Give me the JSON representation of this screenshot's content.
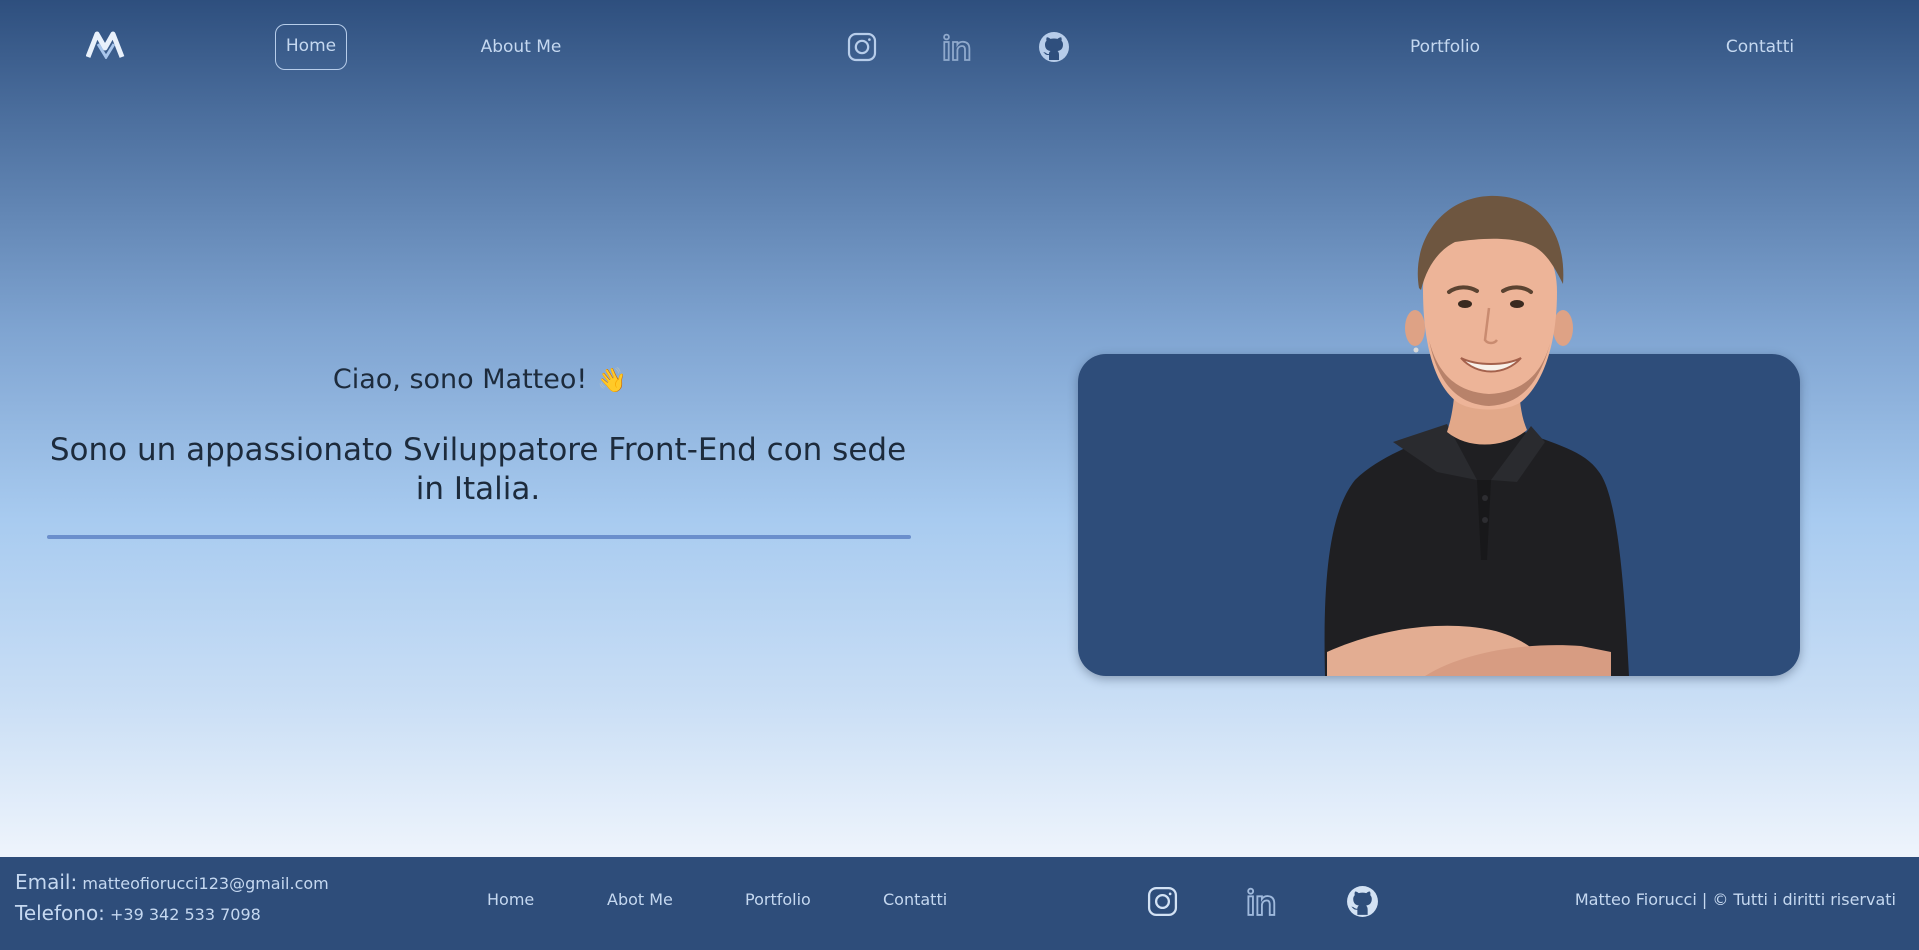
{
  "nav": {
    "logo_icon": "mf-monogram-logo",
    "links": {
      "home": "Home",
      "about": "About Me",
      "portfolio": "Portfolio",
      "contatti": "Contatti"
    },
    "social_icons": [
      "instagram-icon",
      "linkedin-icon",
      "github-icon"
    ]
  },
  "hero": {
    "greeting": "Ciao, sono Matteo!",
    "greeting_emoji": "👋",
    "tagline": "Sono un appassionato Sviluppatore Front-End con sede in Italia."
  },
  "footer": {
    "email_label": "Email:",
    "email": "matteofiorucci123@gmail.com",
    "phone_label": "Telefono:",
    "phone": "+39 342 533 7098",
    "links": {
      "home": "Home",
      "about": "Abot Me",
      "portfolio": "Portfolio",
      "contatti": "Contatti"
    },
    "copyright": "Matteo Fiorucci | © Tutti i diritti riservati"
  },
  "colors": {
    "nav_top": "#2e4f7e",
    "card": "#2e4d7a",
    "footer": "#2e4d7a",
    "accent_rule": "#6b8fcc",
    "link": "#c5d8f0"
  }
}
